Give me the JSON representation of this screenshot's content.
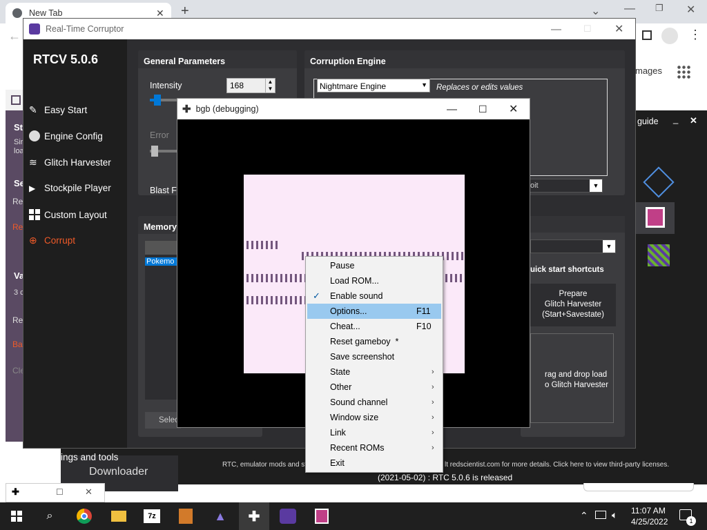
{
  "chrome": {
    "tab_title": "New Tab",
    "new_tab_symbol": "+",
    "images_link": "mages"
  },
  "rtc": {
    "window_title": "Real-Time Corruptor",
    "version": "RTCV 5.0.6",
    "nav": [
      {
        "label": "Easy Start"
      },
      {
        "label": "Engine Config"
      },
      {
        "label": "Glitch Harvester"
      },
      {
        "label": "Stockpile Player"
      },
      {
        "label": "Custom Layout"
      },
      {
        "label": "Corrupt"
      }
    ],
    "settings_label": "Settings and tools",
    "general": {
      "header": "General Parameters",
      "intensity_label": "Intensity",
      "intensity_value": "168",
      "error_label": "Error",
      "blast_label": "Blast F"
    },
    "engine": {
      "header": "Corruption Engine",
      "selected": "Nightmare Engine",
      "description": "Replaces or edits values",
      "second_dropdown": "oit"
    },
    "memory": {
      "header": "Memory",
      "item": "Pokemo",
      "select_button": "Selec"
    },
    "quick_start_label": "uick start shortcuts",
    "prepare_button": "Prepare\nGlitch Harvester\n(Start+Savestate)",
    "drag_drop_text": "rag and drop load\no Glitch Harvester",
    "footer_text": "RTC, emulator mods and st",
    "footer_text_right": "lt redscientist.com for more details. Click here to view third-party licenses.",
    "release_note": "(2021-05-02) : RTC 5.0.6 is released",
    "downloader_label": "Downloader"
  },
  "leftwin": {
    "letters": [
      "St",
      "Sir",
      "loa",
      "Se",
      "Re",
      "Re",
      "Va",
      "3 c",
      "Re",
      "Ba",
      "Cle"
    ]
  },
  "guide_label": "guide",
  "bgb": {
    "window_title": "bgb (debugging)"
  },
  "context_menu": {
    "items": [
      {
        "label": "Pause",
        "shortcut": "",
        "submenu": false,
        "checked": false
      },
      {
        "label": "Load ROM...",
        "shortcut": "",
        "submenu": false,
        "checked": false
      },
      {
        "label": "Enable sound",
        "shortcut": "",
        "submenu": false,
        "checked": true
      },
      {
        "label": "Options...",
        "shortcut": "F11",
        "submenu": false,
        "checked": false,
        "highlighted": true
      },
      {
        "label": "Cheat...",
        "shortcut": "F10",
        "submenu": false,
        "checked": false
      },
      {
        "label": "Reset gameboy  *",
        "shortcut": "",
        "submenu": false,
        "checked": false
      },
      {
        "label": "Save screenshot",
        "shortcut": "",
        "submenu": false,
        "checked": false
      },
      {
        "label": "State",
        "shortcut": "",
        "submenu": true,
        "checked": false
      },
      {
        "label": "Other",
        "shortcut": "",
        "submenu": true,
        "checked": false
      },
      {
        "label": "Sound channel",
        "shortcut": "",
        "submenu": true,
        "checked": false
      },
      {
        "label": "Window size",
        "shortcut": "",
        "submenu": true,
        "checked": false
      },
      {
        "label": "Link",
        "shortcut": "",
        "submenu": true,
        "checked": false
      },
      {
        "label": "Recent ROMs",
        "shortcut": "",
        "submenu": true,
        "checked": false
      },
      {
        "label": "Exit",
        "shortcut": "",
        "submenu": false,
        "checked": false
      }
    ]
  },
  "taskbar": {
    "time": "11:07 AM",
    "date": "4/25/2022",
    "notification_count": "1",
    "apps": [
      "start-icon",
      "search-icon",
      "chrome-icon",
      "file-explorer-icon",
      "7zip-icon",
      "winrar-icon",
      "app-icon",
      "bgb-icon",
      "rtc-icon",
      "notepad-icon"
    ]
  },
  "colors": {
    "rtc_bg": "#2d2d30",
    "accent_orange": "#f05a28",
    "menu_highlight": "#99c9ef",
    "gb_screen": "#fbe9f9",
    "gb_tile": "#73567d"
  }
}
